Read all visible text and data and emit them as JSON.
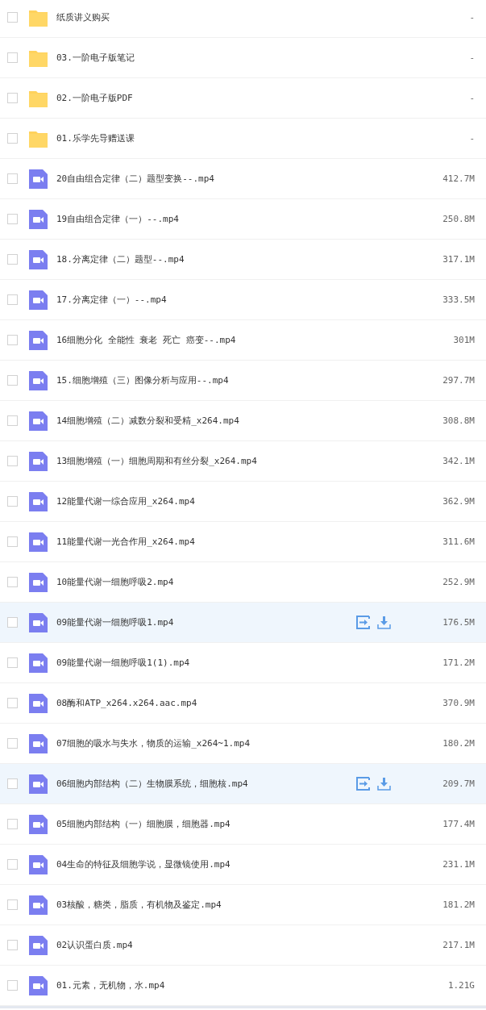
{
  "files": [
    {
      "kind": "folder",
      "name": "纸质讲义购买",
      "size": "-",
      "checked": false,
      "highlighted": false
    },
    {
      "kind": "folder",
      "name": "03.一阶电子版笔记",
      "size": "-",
      "checked": false,
      "highlighted": false
    },
    {
      "kind": "folder",
      "name": "02.一阶电子版PDF",
      "size": "-",
      "checked": false,
      "highlighted": false
    },
    {
      "kind": "folder",
      "name": "01.乐学先导赠送课",
      "size": "-",
      "checked": false,
      "highlighted": false
    },
    {
      "kind": "video",
      "name": "20自由组合定律（二）题型变换--.mp4",
      "size": "412.7M",
      "checked": false,
      "highlighted": false
    },
    {
      "kind": "video",
      "name": "19自由组合定律（一）--.mp4",
      "size": "250.8M",
      "checked": false,
      "highlighted": false
    },
    {
      "kind": "video",
      "name": "18.分离定律（二）题型--.mp4",
      "size": "317.1M",
      "checked": false,
      "highlighted": false
    },
    {
      "kind": "video",
      "name": "17.分离定律（一）--.mp4",
      "size": "333.5M",
      "checked": false,
      "highlighted": false
    },
    {
      "kind": "video",
      "name": "16细胞分化 全能性 衰老 死亡 癌变--.mp4",
      "size": "301M",
      "checked": false,
      "highlighted": false
    },
    {
      "kind": "video",
      "name": "15.细胞增殖（三）图像分析与应用--.mp4",
      "size": "297.7M",
      "checked": false,
      "highlighted": false
    },
    {
      "kind": "video",
      "name": "14细胞增殖（二）减数分裂和受精_x264.mp4",
      "size": "308.8M",
      "checked": false,
      "highlighted": false
    },
    {
      "kind": "video",
      "name": "13细胞增殖（一）细胞周期和有丝分裂_x264.mp4",
      "size": "342.1M",
      "checked": false,
      "highlighted": false
    },
    {
      "kind": "video",
      "name": "12能量代谢一综合应用_x264.mp4",
      "size": "362.9M",
      "checked": false,
      "highlighted": false
    },
    {
      "kind": "video",
      "name": "11能量代谢一光合作用_x264.mp4",
      "size": "311.6M",
      "checked": false,
      "highlighted": false
    },
    {
      "kind": "video",
      "name": "10能量代谢一细胞呼吸2.mp4",
      "size": "252.9M",
      "checked": false,
      "highlighted": false
    },
    {
      "kind": "video",
      "name": "09能量代谢一细胞呼吸1.mp4",
      "size": "176.5M",
      "checked": false,
      "highlighted": true
    },
    {
      "kind": "video",
      "name": "09能量代谢一细胞呼吸1(1).mp4",
      "size": "171.2M",
      "checked": false,
      "highlighted": false
    },
    {
      "kind": "video",
      "name": "08酶和ATP_x264.x264.aac.mp4",
      "size": "370.9M",
      "checked": false,
      "highlighted": false
    },
    {
      "kind": "video",
      "name": "07细胞的吸水与失水，物质的运输_x264~1.mp4",
      "size": "180.2M",
      "checked": false,
      "highlighted": false
    },
    {
      "kind": "video",
      "name": "06细胞内部结构（二）生物膜系统，细胞核.mp4",
      "size": "209.7M",
      "checked": false,
      "highlighted": true
    },
    {
      "kind": "video",
      "name": "05细胞内部结构（一）细胞膜，细胞器.mp4",
      "size": "177.4M",
      "checked": false,
      "highlighted": false
    },
    {
      "kind": "video",
      "name": "04生命的特征及细胞学说，显微镜使用.mp4",
      "size": "231.1M",
      "checked": false,
      "highlighted": false
    },
    {
      "kind": "video",
      "name": "03核酸，糖类，脂质，有机物及鉴定.mp4",
      "size": "181.2M",
      "checked": false,
      "highlighted": false
    },
    {
      "kind": "video",
      "name": "02认识蛋白质.mp4",
      "size": "217.1M",
      "checked": false,
      "highlighted": false
    },
    {
      "kind": "video",
      "name": "01.元素，无机物，水.mp4",
      "size": "1.21G",
      "checked": false,
      "highlighted": false
    }
  ]
}
